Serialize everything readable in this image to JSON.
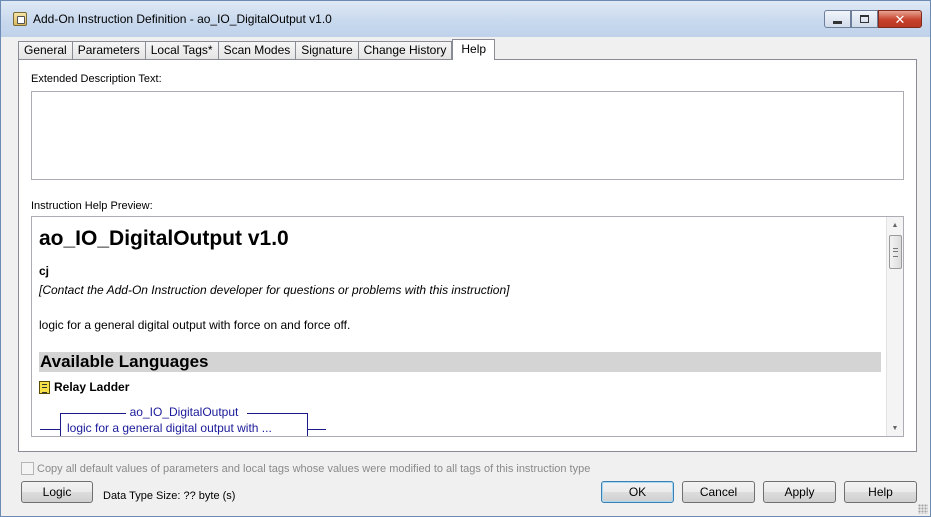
{
  "window": {
    "title": "Add-On Instruction Definition - ao_IO_DigitalOutput v1.0",
    "icon": "aoi-definition-icon",
    "controls": {
      "minimize": "minimize-icon",
      "maximize": "maximize-icon",
      "close": "✕"
    }
  },
  "tabs": [
    {
      "label": "General",
      "active": false
    },
    {
      "label": "Parameters",
      "active": false
    },
    {
      "label": "Local Tags*",
      "active": false
    },
    {
      "label": "Scan Modes",
      "active": false
    },
    {
      "label": "Signature",
      "active": false
    },
    {
      "label": "Change History",
      "active": false
    },
    {
      "label": "Help",
      "active": true
    }
  ],
  "help": {
    "extended_description_label": "Extended Description Text:",
    "extended_description_value": "",
    "preview_label": "Instruction Help Preview:",
    "preview": {
      "title": "ao_IO_DigitalOutput v1.0",
      "author": "cj",
      "contact": "[Contact the Add-On Instruction developer for questions or problems with this instruction]",
      "description": "logic for a general digital output with force on and force off.",
      "languages_heading": "Available Languages",
      "language": "Relay Ladder",
      "rung_title": "ao_IO_DigitalOutput",
      "rung_desc": "logic for a general digital output with ..."
    }
  },
  "footer": {
    "copy_defaults_label": "Copy all default values of parameters and local tags whose values were modified to all tags of this instruction type",
    "copy_defaults_checked": false,
    "logic_button": "Logic",
    "data_type_size": "Data Type Size: ?? byte (s)",
    "ok_button": "OK",
    "cancel_button": "Cancel",
    "apply_button": "Apply",
    "help_button": "Help"
  }
}
